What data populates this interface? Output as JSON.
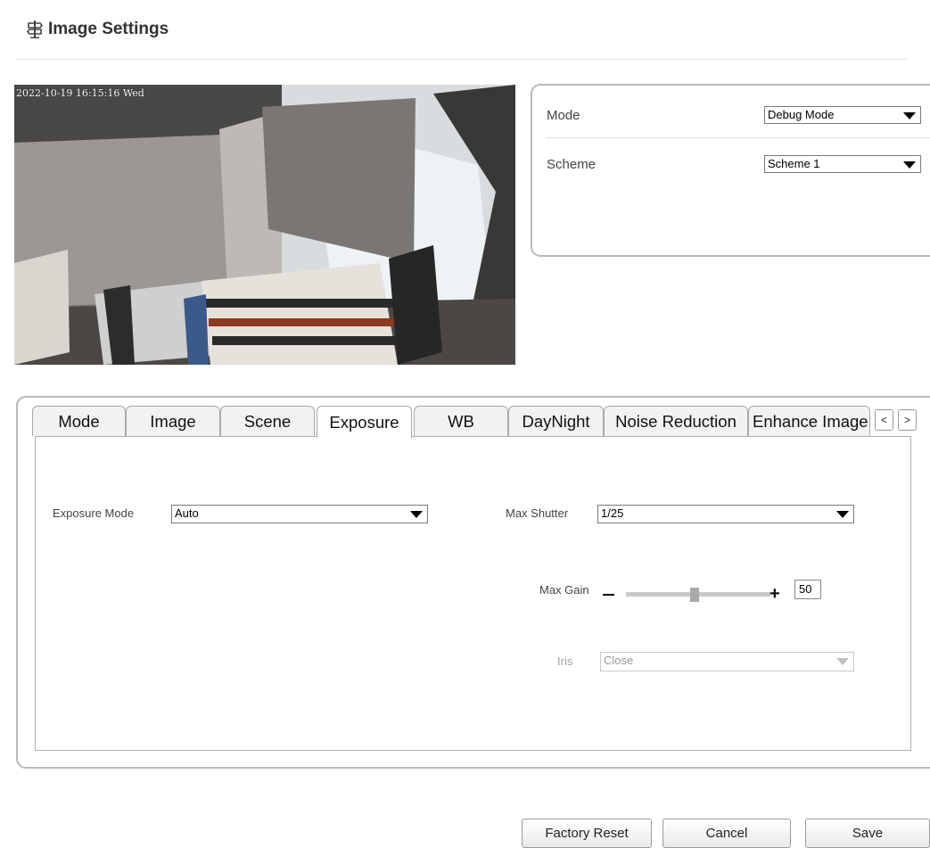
{
  "header": {
    "title": "Image Settings",
    "icon": "signpost-icon"
  },
  "preview": {
    "osd_text": "2022-10-19 16:15:16 Wed"
  },
  "mode_panel": {
    "mode_label": "Mode",
    "mode_value": "Debug Mode",
    "scheme_label": "Scheme",
    "scheme_value": "Scheme 1"
  },
  "tabs": [
    {
      "label": "Mode"
    },
    {
      "label": "Image"
    },
    {
      "label": "Scene"
    },
    {
      "label": "Exposure"
    },
    {
      "label": "WB"
    },
    {
      "label": "DayNight"
    },
    {
      "label": "Noise Reduction"
    },
    {
      "label": "Enhance Image"
    }
  ],
  "active_tab": "Exposure",
  "tab_nav": {
    "prev": "<",
    "next": ">"
  },
  "exposure": {
    "exposure_mode_label": "Exposure Mode",
    "exposure_mode_value": "Auto",
    "max_shutter_label": "Max Shutter",
    "max_shutter_value": "1/25",
    "max_gain_label": "Max Gain",
    "max_gain_value": "50",
    "iris_label": "Iris",
    "iris_value": "Close"
  },
  "buttons": {
    "factory_reset": "Factory Reset",
    "cancel": "Cancel",
    "save": "Save"
  }
}
